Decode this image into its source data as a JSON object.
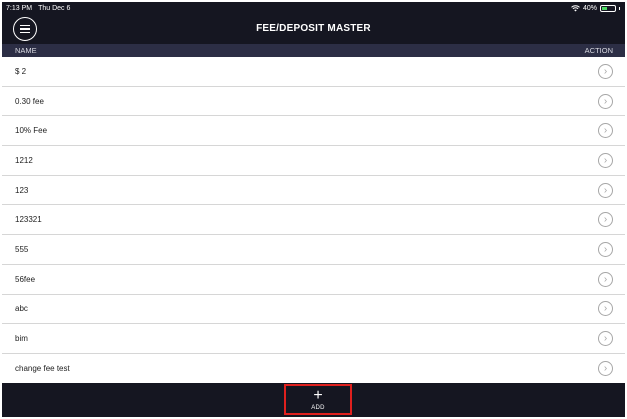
{
  "status": {
    "time": "7:13 PM",
    "date": "Thu Dec 6",
    "wifi_icon": "wifi-icon",
    "battery_percent": "40%",
    "battery_level": 0.4
  },
  "header": {
    "menu_icon": "hamburger-menu-icon",
    "title": "FEE/DEPOSIT MASTER"
  },
  "columns": {
    "name": "NAME",
    "action": "ACTION"
  },
  "rows": [
    {
      "label": "$ 2"
    },
    {
      "label": "0.30 fee"
    },
    {
      "label": "10% Fee"
    },
    {
      "label": "1212"
    },
    {
      "label": "123"
    },
    {
      "label": "123321"
    },
    {
      "label": "555"
    },
    {
      "label": "56fee"
    },
    {
      "label": "abc"
    },
    {
      "label": "bim"
    },
    {
      "label": "change fee test"
    }
  ],
  "row_action_icon": "chevron-right-circle-icon",
  "bottom": {
    "add_icon": "plus-icon",
    "add_label": "ADD"
  },
  "colors": {
    "bar_background": "#151621",
    "column_header_background": "#2c2e45",
    "highlight_border": "#e0201e",
    "battery_fill": "#4cd964"
  }
}
